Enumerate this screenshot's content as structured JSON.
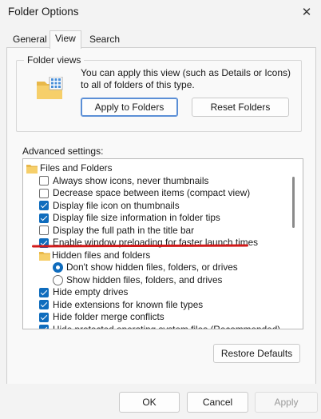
{
  "window": {
    "title": "Folder Options",
    "close_glyph": "✕"
  },
  "tabs": [
    "General",
    "View",
    "Search"
  ],
  "active_tab": "View",
  "folder_views": {
    "label": "Folder views",
    "description": "You can apply this view (such as Details or Icons) to all of folders of this type.",
    "apply_button": "Apply to Folders",
    "reset_button": "Reset Folders"
  },
  "advanced": {
    "label": "Advanced settings:",
    "items": [
      {
        "type": "folder",
        "label": "Files and Folders"
      },
      {
        "type": "checkbox",
        "checked": false,
        "label": "Always show icons, never thumbnails"
      },
      {
        "type": "checkbox",
        "checked": false,
        "label": "Decrease space between items (compact view)"
      },
      {
        "type": "checkbox",
        "checked": true,
        "label": "Display file icon on thumbnails"
      },
      {
        "type": "checkbox",
        "checked": true,
        "label": "Display file size information in folder tips"
      },
      {
        "type": "checkbox",
        "checked": false,
        "label": "Display the full path in the title bar"
      },
      {
        "type": "checkbox",
        "checked": true,
        "label": "Enable window preloading for faster launch times"
      },
      {
        "type": "folder",
        "label": "Hidden files and folders"
      },
      {
        "type": "radio",
        "checked": true,
        "label": "Don't show hidden files, folders, or drives"
      },
      {
        "type": "radio",
        "checked": false,
        "label": "Show hidden files, folders, and drives"
      },
      {
        "type": "checkbox",
        "checked": true,
        "label": "Hide empty drives"
      },
      {
        "type": "checkbox",
        "checked": true,
        "label": "Hide extensions for known file types"
      },
      {
        "type": "checkbox",
        "checked": true,
        "label": "Hide folder merge conflicts"
      },
      {
        "type": "checkbox",
        "checked": true,
        "label": "Hide protected operating system files (Recommended)"
      }
    ]
  },
  "restore_defaults": "Restore Defaults",
  "footer": {
    "ok": "OK",
    "cancel": "Cancel",
    "apply": "Apply"
  },
  "colors": {
    "accent": "#0f6cbd",
    "annotation": "#d21a1a"
  }
}
